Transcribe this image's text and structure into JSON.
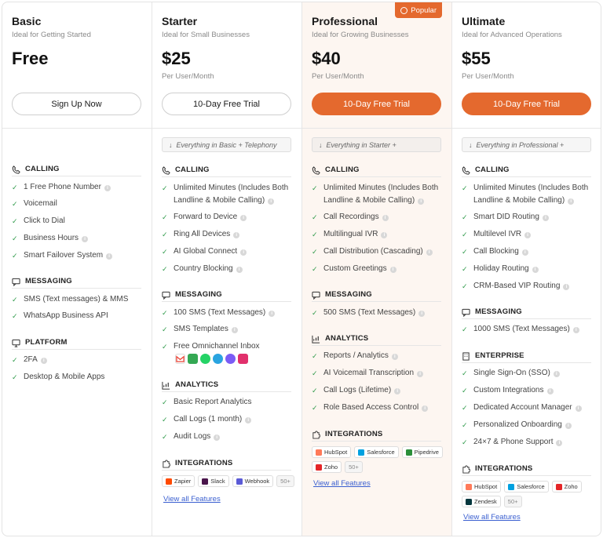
{
  "plans": [
    {
      "name": "Basic",
      "subtitle": "Ideal for Getting Started",
      "price": "Free",
      "unit": "",
      "cta": "Sign Up Now",
      "inherit": "",
      "sections": [
        {
          "title": "CALLING",
          "icon": "phone-icon",
          "features": [
            {
              "text": "1 Free Phone Number",
              "info": true
            },
            {
              "text": "Voicemail",
              "info": false
            },
            {
              "text": "Click to Dial",
              "info": false
            },
            {
              "text": "Business Hours",
              "info": true
            },
            {
              "text": "Smart Failover System",
              "info": true
            }
          ]
        },
        {
          "title": "MESSAGING",
          "icon": "message-icon",
          "features": [
            {
              "text": "SMS (Text messages) & MMS",
              "info": false
            },
            {
              "text": "WhatsApp Business API",
              "info": false
            }
          ]
        },
        {
          "title": "PLATFORM",
          "icon": "monitor-icon",
          "features": [
            {
              "text": "2FA",
              "info": true
            },
            {
              "text": "Desktop & Mobile Apps",
              "info": false
            }
          ]
        }
      ]
    },
    {
      "name": "Starter",
      "subtitle": "Ideal for Small Businesses",
      "price": "$25",
      "unit": "Per User/Month",
      "cta": "10-Day Free Trial",
      "inherit": "Everything in Basic + Telephony",
      "sections": [
        {
          "title": "CALLING",
          "icon": "phone-icon",
          "features": [
            {
              "text": "Unlimited Minutes (Includes Both Landline & Mobile Calling)",
              "info": true
            },
            {
              "text": "Forward to Device",
              "info": true
            },
            {
              "text": "Ring All Devices",
              "info": true
            },
            {
              "text": "AI Global Connect",
              "info": true
            },
            {
              "text": "Country Blocking",
              "info": true
            }
          ]
        },
        {
          "title": "MESSAGING",
          "icon": "message-icon",
          "features": [
            {
              "text": "100 SMS (Text Messages)",
              "info": true
            },
            {
              "text": "SMS Templates",
              "info": true
            },
            {
              "text": "Free Omnichannel Inbox",
              "info": false
            }
          ]
        },
        {
          "title": "ANALYTICS",
          "icon": "chart-icon",
          "features": [
            {
              "text": "Basic Report Analytics",
              "info": false
            },
            {
              "text": "Call Logs (1 month)",
              "info": true
            },
            {
              "text": "Audit Logs",
              "info": true
            }
          ]
        },
        {
          "title": "INTEGRATIONS",
          "icon": "puzzle-icon",
          "features": []
        }
      ],
      "integrations": [
        "Zapier",
        "Slack",
        "Webhook"
      ],
      "more": "50+",
      "view_all": "View all Features"
    },
    {
      "name": "Professional",
      "subtitle": "Ideal for Growing Businesses",
      "price": "$40",
      "unit": "Per User/Month",
      "cta": "10-Day Free Trial",
      "badge": "Popular",
      "inherit": "Everything in Starter +",
      "sections": [
        {
          "title": "CALLING",
          "icon": "phone-icon",
          "features": [
            {
              "text": "Unlimited Minutes (Includes Both Landline & Mobile Calling)",
              "info": true
            },
            {
              "text": "Call Recordings",
              "info": true
            },
            {
              "text": "Multilingual IVR",
              "info": true
            },
            {
              "text": "Call Distribution (Cascading)",
              "info": true
            },
            {
              "text": "Custom Greetings",
              "info": true
            }
          ]
        },
        {
          "title": "MESSAGING",
          "icon": "message-icon",
          "features": [
            {
              "text": "500 SMS (Text Messages)",
              "info": true
            }
          ]
        },
        {
          "title": "ANALYTICS",
          "icon": "chart-icon",
          "features": [
            {
              "text": "Reports / Analytics",
              "info": true
            },
            {
              "text": "AI Voicemail Transcription",
              "info": true
            },
            {
              "text": "Call Logs (Lifetime)",
              "info": true
            },
            {
              "text": "Role Based Access Control",
              "info": true
            }
          ]
        },
        {
          "title": "INTEGRATIONS",
          "icon": "puzzle-icon",
          "features": []
        }
      ],
      "integrations": [
        "HubSpot",
        "Salesforce",
        "Pipedrive",
        "Zoho"
      ],
      "more": "50+",
      "view_all": "View all Features"
    },
    {
      "name": "Ultimate",
      "subtitle": "Ideal for Advanced Operations",
      "price": "$55",
      "unit": "Per User/Month",
      "cta": "10-Day Free Trial",
      "inherit": "Everything in Professional +",
      "sections": [
        {
          "title": "CALLING",
          "icon": "phone-icon",
          "features": [
            {
              "text": "Unlimited Minutes (Includes Both Landline & Mobile Calling)",
              "info": true
            },
            {
              "text": "Smart DID Routing",
              "info": true
            },
            {
              "text": "Multilevel IVR",
              "info": true
            },
            {
              "text": "Call Blocking",
              "info": true
            },
            {
              "text": "Holiday Routing",
              "info": true
            },
            {
              "text": "CRM-Based VIP Routing",
              "info": true
            }
          ]
        },
        {
          "title": "MESSAGING",
          "icon": "message-icon",
          "features": [
            {
              "text": "1000 SMS (Text Messages)",
              "info": true
            }
          ]
        },
        {
          "title": "ENTERPRISE",
          "icon": "building-icon",
          "features": [
            {
              "text": "Single Sign-On (SSO)",
              "info": true
            },
            {
              "text": "Custom Integrations",
              "info": true
            },
            {
              "text": "Dedicated Account Manager",
              "info": true
            },
            {
              "text": "Personalized Onboarding",
              "info": true
            },
            {
              "text": "24×7 & Phone Support",
              "info": true
            }
          ]
        },
        {
          "title": "INTEGRATIONS",
          "icon": "puzzle-icon",
          "features": []
        }
      ],
      "integrations": [
        "HubSpot",
        "Salesforce",
        "Zoho",
        "Zendesk"
      ],
      "more": "50+",
      "view_all": "View all Features"
    }
  ],
  "colors": {
    "accent": "#e4692e",
    "check": "#2f9a4a",
    "link": "#3a5fd0"
  },
  "integration_logos": {
    "Zapier": "#ff4a00",
    "Slack": "#4a154b",
    "Webhook": "#5a5ad6",
    "HubSpot": "#ff7a59",
    "Salesforce": "#00a1e0",
    "Pipedrive": "#1a1a1a",
    "Zoho": "#e42527",
    "Zendesk": "#03363d"
  },
  "omnichannel_apps": [
    "gmail-icon",
    "chat-icon",
    "whatsapp-icon",
    "telegram-icon",
    "messenger-icon",
    "instagram-icon"
  ]
}
